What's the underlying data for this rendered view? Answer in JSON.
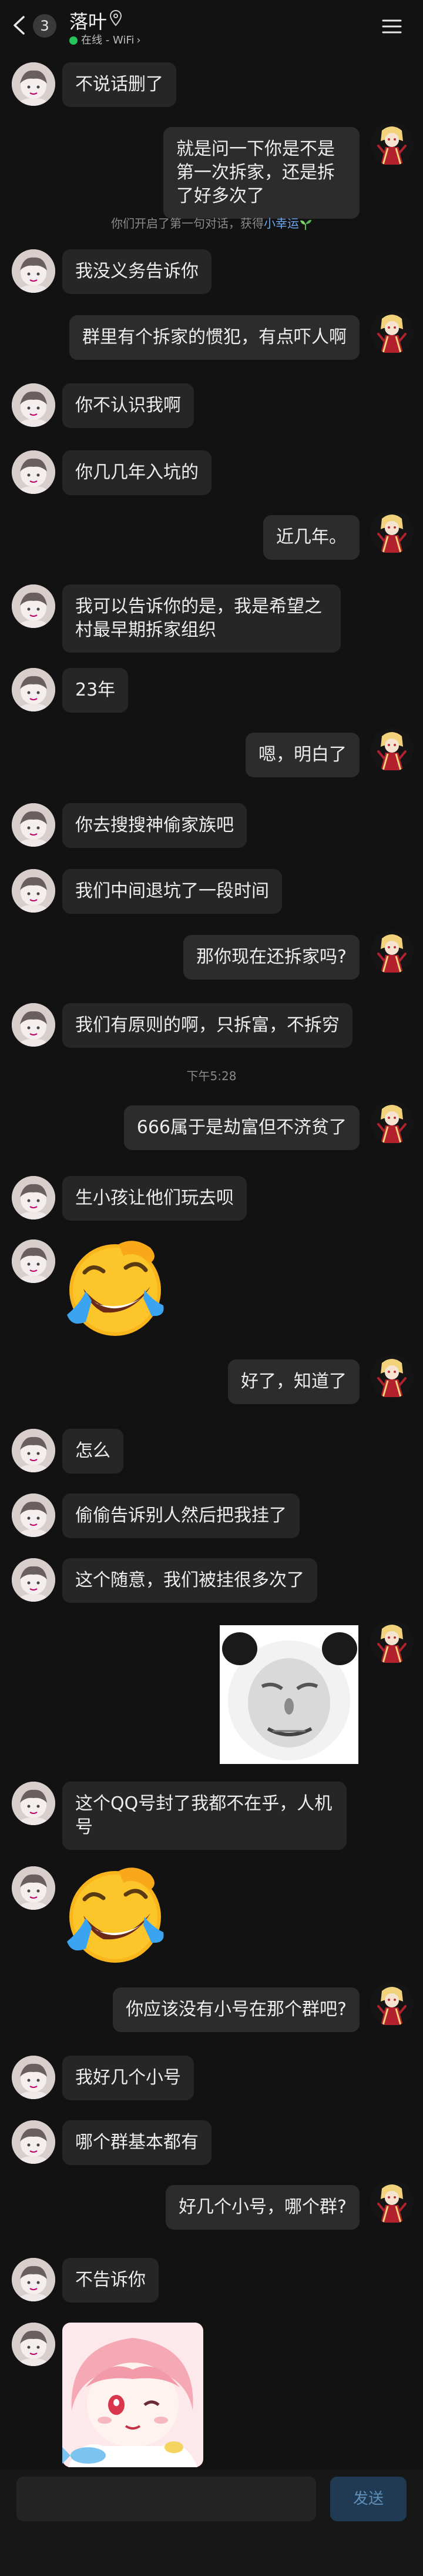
{
  "header": {
    "unread_count": "3",
    "contact_name": "落叶",
    "status_text": "在线 - WiFi",
    "status_color": "#25c45a"
  },
  "messages": [
    {
      "side": "recv",
      "text": "不说话删了"
    },
    {
      "side": "sent",
      "text": "就是问一下你是不是第一次拆家，还是拆了好多次了"
    },
    {
      "side": "system",
      "text_before": "你们开启了第一句对话，获得",
      "link": "小幸运",
      "icon": "sprout-icon"
    },
    {
      "side": "recv",
      "text": "我没义务告诉你"
    },
    {
      "side": "sent",
      "text": "群里有个拆家的惯犯，有点吓人啊"
    },
    {
      "side": "recv",
      "text": "你不认识我啊"
    },
    {
      "side": "recv",
      "text": "你几几年入坑的"
    },
    {
      "side": "sent",
      "text": "近几年。"
    },
    {
      "side": "recv",
      "text": "我可以告诉你的是，我是希望之村最早期拆家组织"
    },
    {
      "side": "recv",
      "text": "23年"
    },
    {
      "side": "sent",
      "text": "嗯，明白了"
    },
    {
      "side": "recv",
      "text": "你去搜搜神偷家族吧"
    },
    {
      "side": "recv",
      "text": "我们中间退坑了一段时间"
    },
    {
      "side": "sent",
      "text": "那你现在还拆家吗?"
    },
    {
      "side": "recv",
      "text": "我们有原则的啊，只拆富，不拆穷"
    },
    {
      "side": "time",
      "text": "下午5:28"
    },
    {
      "side": "sent",
      "text": "666属于是劫富但不济贫了"
    },
    {
      "side": "recv",
      "text": "生小孩让他们玩去呗"
    },
    {
      "side": "recv",
      "sticker": "laughing-emoji-sticker"
    },
    {
      "side": "sent",
      "text": "好了，知道了"
    },
    {
      "side": "recv",
      "text": "怎么"
    },
    {
      "side": "recv",
      "text": "偷偷告诉别人然后把我挂了"
    },
    {
      "side": "recv",
      "text": "这个随意，我们被挂很多次了"
    },
    {
      "side": "sent",
      "sticker": "panda-meme-sticker"
    },
    {
      "side": "recv",
      "text": "这个QQ号封了我都不在乎，人机号"
    },
    {
      "side": "recv",
      "sticker": "laughing-emoji-sticker"
    },
    {
      "side": "sent",
      "text": "你应该没有小号在那个群吧?"
    },
    {
      "side": "recv",
      "text": "我好几个小号"
    },
    {
      "side": "recv",
      "text": "哪个群基本都有"
    },
    {
      "side": "sent",
      "text": "好几个小号，哪个群?"
    },
    {
      "side": "recv",
      "text": "不告诉你"
    },
    {
      "side": "recv",
      "sticker": "anime-girl-sticker"
    }
  ],
  "composer": {
    "placeholder": "",
    "send_label": "发送"
  }
}
